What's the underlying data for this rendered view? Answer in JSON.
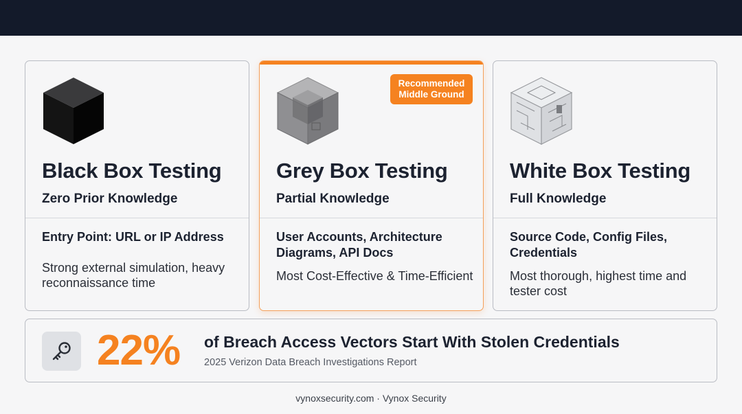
{
  "cards": [
    {
      "title": "Black Box Testing",
      "subtitle": "Zero Prior Knowledge",
      "detail": "Entry Point: URL or IP Address",
      "note": "Strong external simulation, heavy reconnaissance time",
      "icon": "black-cube-icon"
    },
    {
      "title": "Grey Box Testing",
      "subtitle": "Partial Knowledge",
      "detail": "User Accounts, Architecture Diagrams, API Docs",
      "note": "Most Cost-Effective & Time-Efficient",
      "icon": "grey-cube-icon",
      "badge_line1": "Recommended",
      "badge_line2": "Middle Ground"
    },
    {
      "title": "White Box Testing",
      "subtitle": "Full Knowledge",
      "detail": "Source Code, Config Files, Credentials",
      "note": "Most thorough, highest time and tester cost",
      "icon": "white-cube-icon"
    }
  ],
  "stat": {
    "value": "22%",
    "headline": "of Breach Access Vectors Start With Stolen Credentials",
    "source": "2025 Verizon Data Breach Investigations Report",
    "icon": "key-icon"
  },
  "footer": "vynoxsecurity.com · Vynox Security",
  "colors": {
    "accent": "#f58220",
    "header": "#131a2a",
    "text": "#1c2230"
  }
}
